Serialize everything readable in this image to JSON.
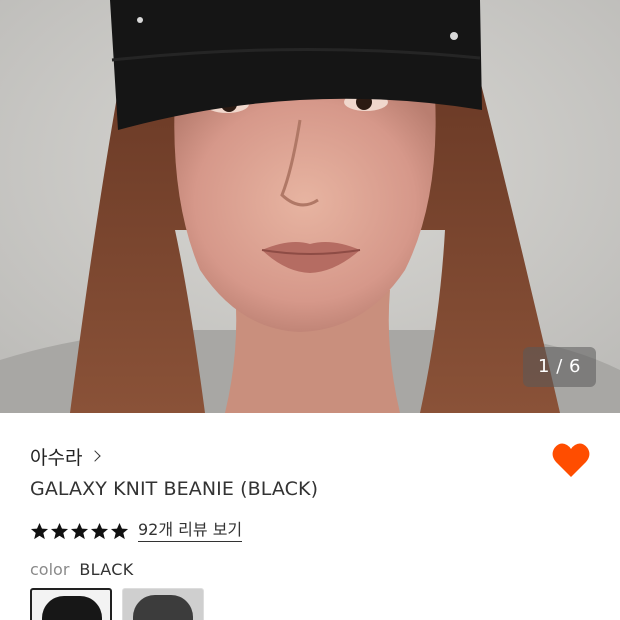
{
  "gallery": {
    "image_alt_icon": "model-photo",
    "counter_text": "1 / 6"
  },
  "product": {
    "brand": "아수라",
    "title": "GALAXY KNIT BEANIE (BLACK)",
    "rating": 5,
    "review_link": "92개 리뷰 보기",
    "color_label": "color",
    "color_value": "BLACK",
    "favorite_color": "#ff4d00",
    "swatches": [
      {
        "name": "BLACK",
        "selected": true
      },
      {
        "name": "GRAY",
        "selected": false
      }
    ]
  }
}
